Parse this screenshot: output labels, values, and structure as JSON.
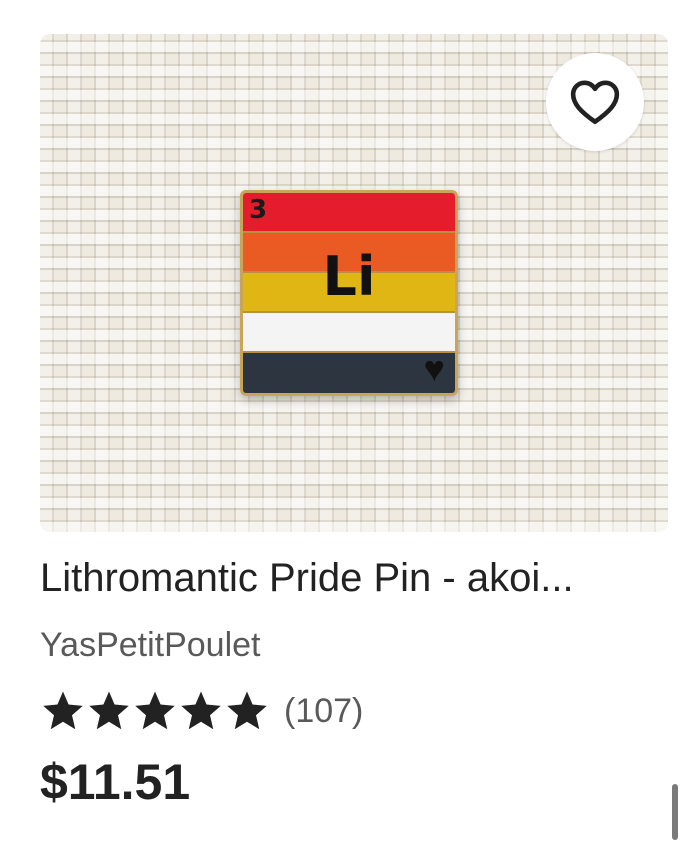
{
  "listing": {
    "pin": {
      "number": "3",
      "symbol": "Li",
      "stripe_colors": [
        "#e51c2c",
        "#ea5a23",
        "#dfb614",
        "#f4f4f4",
        "#2d3540"
      ]
    },
    "favorite_icon": "heart-outline-icon",
    "title": "Lithromantic Pride Pin - akoi...",
    "shop_name": "YasPetitPoulet",
    "rating": {
      "stars": 5,
      "review_count": "(107)"
    },
    "price": "$11.51"
  }
}
